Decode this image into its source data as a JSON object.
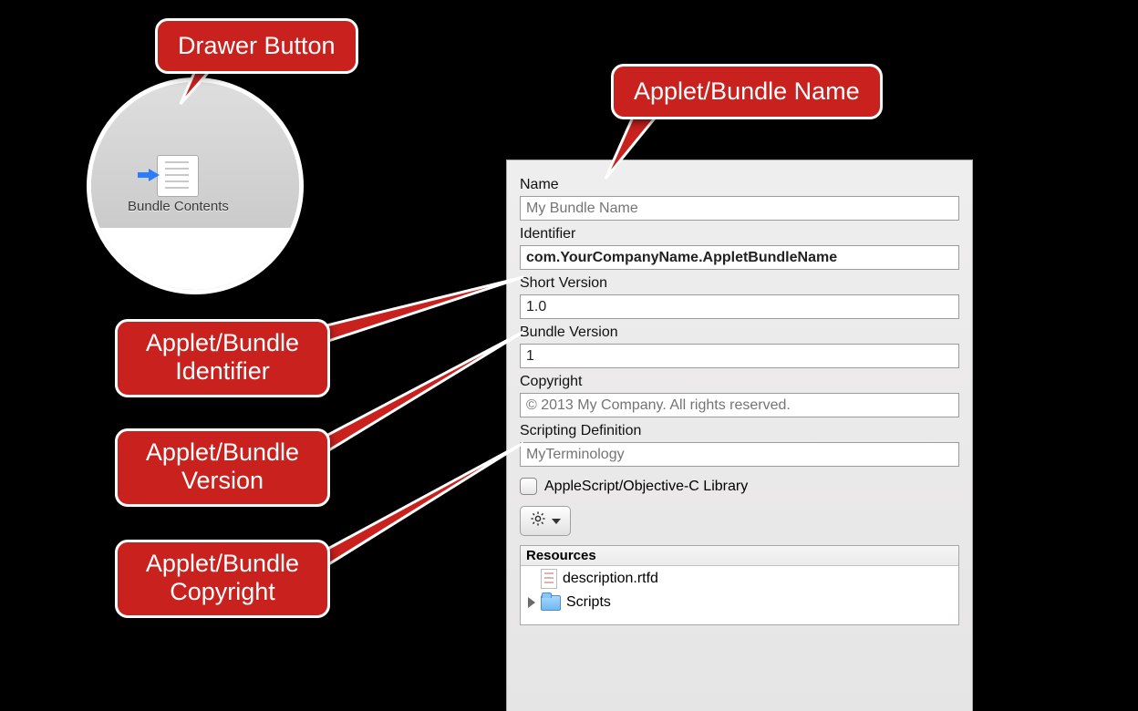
{
  "callouts": {
    "drawer": "Drawer Button",
    "name": "Applet/Bundle Name",
    "identifier": "Applet/Bundle\nIdentifier",
    "version": "Applet/Bundle\nVersion",
    "copyright": "Applet/Bundle\nCopyright"
  },
  "circle": {
    "button_label": "Bundle Contents"
  },
  "panel": {
    "name_label": "Name",
    "name_placeholder": "My Bundle Name",
    "identifier_label": "Identifier",
    "identifier_value": "com.YourCompanyName.AppletBundleName",
    "shortver_label": "Short Version",
    "shortver_value": "1.0",
    "bundlever_label": "Bundle Version",
    "bundlever_value": "1",
    "copyright_label": "Copyright",
    "copyright_placeholder": "© 2013 My Company. All rights reserved.",
    "sdef_label": "Scripting Definition",
    "sdef_placeholder": "MyTerminology",
    "checkbox_label": "AppleScript/Objective-C Library",
    "resources_header": "Resources",
    "res_item_desc": "description.rtfd",
    "res_item_scripts": "Scripts"
  }
}
